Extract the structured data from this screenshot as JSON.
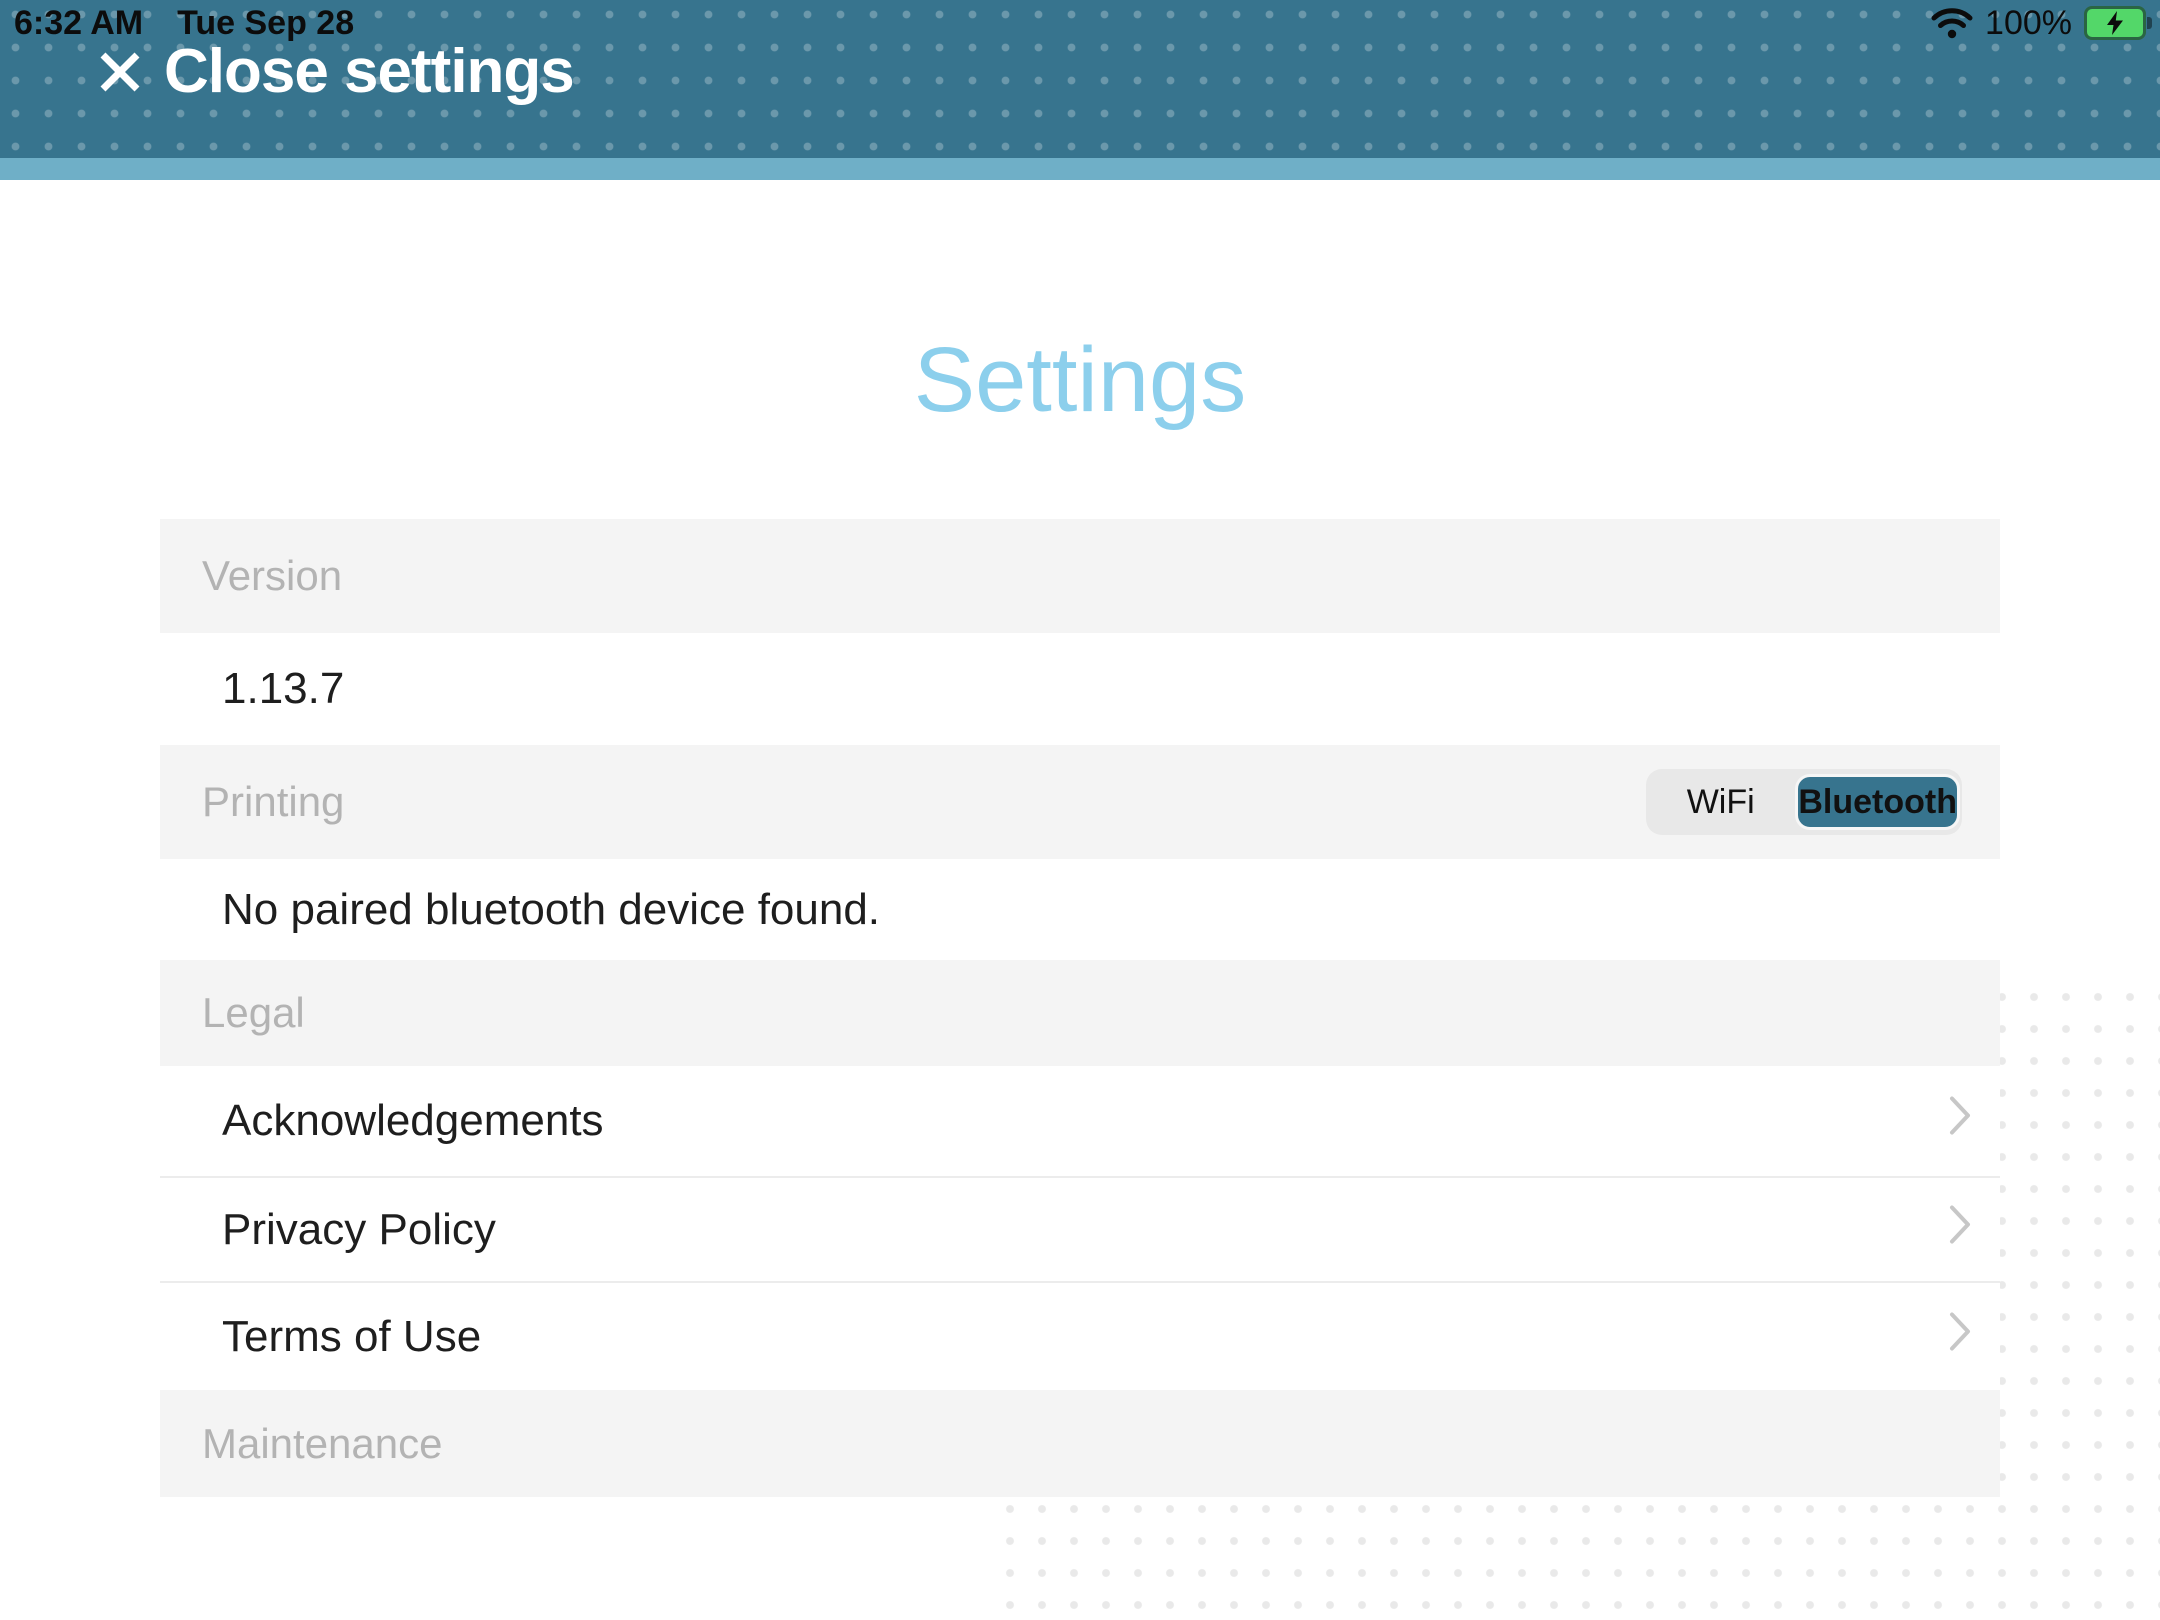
{
  "status_bar": {
    "time": "6:32 AM",
    "date": "Tue Sep 28",
    "battery_percent": "100%"
  },
  "header": {
    "close_label": "Close settings"
  },
  "title": "Settings",
  "sections": {
    "version": {
      "label": "Version",
      "value": "1.13.7"
    },
    "printing": {
      "label": "Printing",
      "status": "No paired bluetooth device found.",
      "toggle": {
        "options": [
          "WiFi",
          "Bluetooth"
        ],
        "selected": "Bluetooth"
      }
    },
    "legal": {
      "label": "Legal",
      "items": [
        "Acknowledgements",
        "Privacy Policy",
        "Terms of Use"
      ]
    },
    "maintenance": {
      "label": "Maintenance"
    }
  },
  "icons": {
    "close": "x-icon",
    "wifi": "wifi-icon",
    "battery": "battery-charging-icon",
    "chevron": "chevron-right-icon"
  },
  "colors": {
    "header_teal": "#37748E",
    "header_strip": "#6FAFC7",
    "title_blue": "#8CCFEC",
    "selected_segment_teal": "#37748E",
    "battery_green": "#53D769",
    "section_header_bg": "#F4F4F4",
    "section_header_text": "#B3B3B3"
  }
}
